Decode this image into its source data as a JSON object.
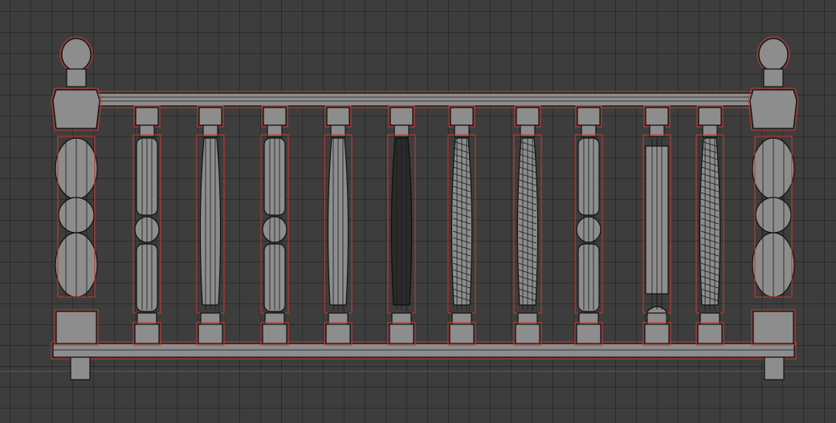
{
  "viewport": {
    "mode": "wireframe-overlay",
    "background": "#3d3d3d",
    "grid_color": "#303030",
    "axis_x_color": "#9a3b3b",
    "selection_outline_color": "#c23a2e",
    "mesh_color": "#8d8d8d"
  },
  "model": {
    "object": "balustrade",
    "posts": 2,
    "balusters": [
      {
        "style": "turned-block"
      },
      {
        "style": "turned-vase"
      },
      {
        "style": "turned-ball"
      },
      {
        "style": "turned-long-vase"
      },
      {
        "style": "slim-dark"
      },
      {
        "style": "spiral-thread"
      },
      {
        "style": "twisted"
      },
      {
        "style": "square-vase"
      },
      {
        "style": "fluted-column"
      },
      {
        "style": "twisted-tight"
      }
    ]
  }
}
